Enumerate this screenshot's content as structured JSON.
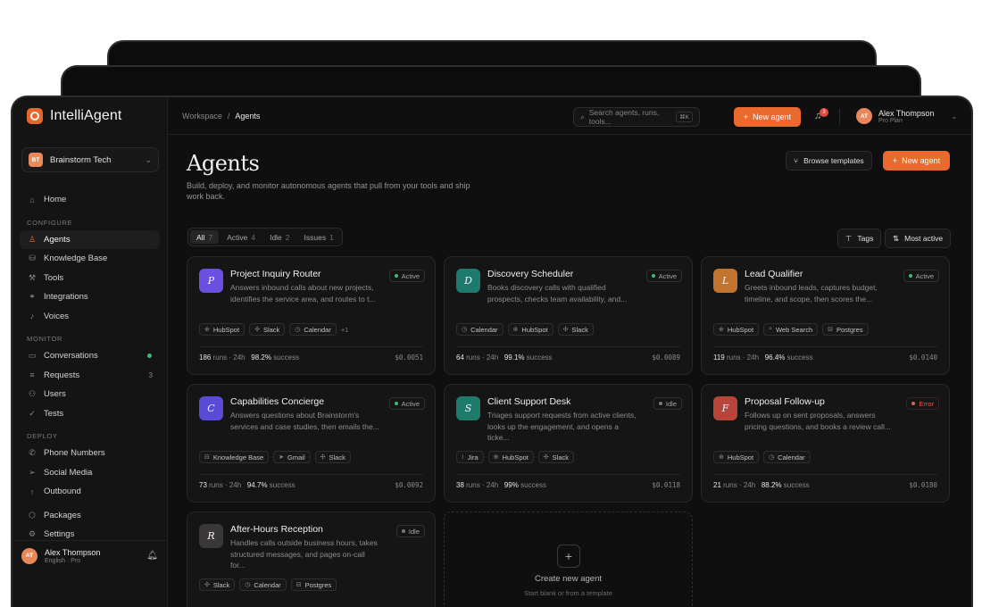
{
  "brand": {
    "name": "IntelliAgent",
    "color": "#ea6a2e"
  },
  "org": {
    "initials": "BT",
    "name": "Brainstorm Tech"
  },
  "sidebar": {
    "home": "Home",
    "sections": {
      "configure": "CONFIGURE",
      "monitor": "MONITOR",
      "deploy": "DEPLOY"
    },
    "configure": [
      "Agents",
      "Knowledge Base",
      "Tools",
      "Integrations",
      "Voices"
    ],
    "monitor": [
      "Conversations",
      "Requests",
      "Users",
      "Tests"
    ],
    "requests_count": "3",
    "deploy": [
      "Phone Numbers",
      "Social Media",
      "Outbound"
    ],
    "extra": [
      "Packages",
      "Settings"
    ],
    "active_item": "Agents"
  },
  "user": {
    "initials": "AT",
    "name": "Alex Thompson",
    "meta": "English · Pro",
    "plan": "Pro Plan"
  },
  "topbar": {
    "breadcrumb": [
      "Workspace",
      "/",
      "Agents"
    ],
    "search_placeholder": "Search agents, runs, tools...",
    "search_kbd": "⌘K",
    "new_agent": "New agent",
    "notifications": "3"
  },
  "header": {
    "title": "Agents",
    "subtitle": "Build, deploy, and monitor autonomous agents that pull from your tools and ship work back.",
    "browse": "Browse templates",
    "new_agent": "New agent"
  },
  "filters": [
    {
      "label": "All",
      "count": "7"
    },
    {
      "label": "Active",
      "count": "4"
    },
    {
      "label": "Idle",
      "count": "2"
    },
    {
      "label": "Issues",
      "count": "1"
    }
  ],
  "toolbar": {
    "tags": "Tags",
    "sort": "Most active"
  },
  "agents": [
    {
      "initial": "P",
      "name": "Project Inquiry Router",
      "desc": "Answers inbound calls about new projects, identifies the service area, and routes to t...",
      "status": "Active",
      "tools": [
        "HubSpot",
        "Slack",
        "Calendar"
      ],
      "more": "+1",
      "runs": "186",
      "runs_label": "runs · 24h",
      "success": "98.2%",
      "success_label": "success",
      "cost": "$0.0051"
    },
    {
      "initial": "D",
      "name": "Discovery Scheduler",
      "desc": "Books discovery calls with qualified prospects, checks team availability, and...",
      "status": "Active",
      "tools": [
        "Calendar",
        "HubSpot",
        "Slack"
      ],
      "more": "",
      "runs": "64",
      "runs_label": "runs · 24h",
      "success": "99.1%",
      "success_label": "success",
      "cost": "$0.0089"
    },
    {
      "initial": "L",
      "name": "Lead Qualifier",
      "desc": "Greets inbound leads, captures budget, timeline, and scope, then scores the...",
      "status": "Active",
      "tools": [
        "HubSpot",
        "Web Search",
        "Postgres"
      ],
      "more": "",
      "runs": "119",
      "runs_label": "runs · 24h",
      "success": "96.4%",
      "success_label": "success",
      "cost": "$0.0140"
    },
    {
      "initial": "C",
      "name": "Capabilities Concierge",
      "desc": "Answers questions about Brainstorm's services and case studies, then emails the...",
      "status": "Active",
      "tools": [
        "Knowledge Base",
        "Gmail",
        "Slack"
      ],
      "more": "",
      "runs": "73",
      "runs_label": "runs · 24h",
      "success": "94.7%",
      "success_label": "success",
      "cost": "$0.0092"
    },
    {
      "initial": "S",
      "name": "Client Support Desk",
      "desc": "Triages support requests from active clients, looks up the engagement, and opens a ticke...",
      "status": "Idle",
      "tools": [
        "Jira",
        "HubSpot",
        "Slack"
      ],
      "more": "",
      "runs": "38",
      "runs_label": "runs · 24h",
      "success": "99%",
      "success_label": "success",
      "cost": "$0.0118"
    },
    {
      "initial": "F",
      "name": "Proposal Follow-up",
      "desc": "Follows up on sent proposals, answers pricing questions, and books a review call...",
      "status": "Error",
      "tools": [
        "HubSpot",
        "Calendar"
      ],
      "more": "",
      "runs": "21",
      "runs_label": "runs · 24h",
      "success": "88.2%",
      "success_label": "success",
      "cost": "$0.0180"
    },
    {
      "initial": "R",
      "name": "After-Hours Reception",
      "desc": "Handles calls outside business hours, takes structured messages, and pages on-call for...",
      "status": "Idle",
      "tools": [
        "Slack",
        "Calendar",
        "Postgres"
      ],
      "more": "",
      "runs": "",
      "runs_label": "",
      "success": "",
      "success_label": "",
      "cost": ""
    }
  ],
  "create_card": {
    "title": "Create new agent",
    "subtitle": "Start blank or from a template"
  },
  "tile_colors": [
    "#6b4fe0",
    "#1f7a6e",
    "#c0742e",
    "#5a4bd6",
    "#1e7b6a",
    "#b8453a",
    "#3a3836"
  ],
  "tool_icons": {
    "HubSpot": "⊕",
    "Slack": "✣",
    "Calendar": "◷",
    "Web Search": "⌕",
    "Postgres": "⊟",
    "Knowledge Base": "⊟",
    "Gmail": "➤",
    "Jira": "≀"
  }
}
